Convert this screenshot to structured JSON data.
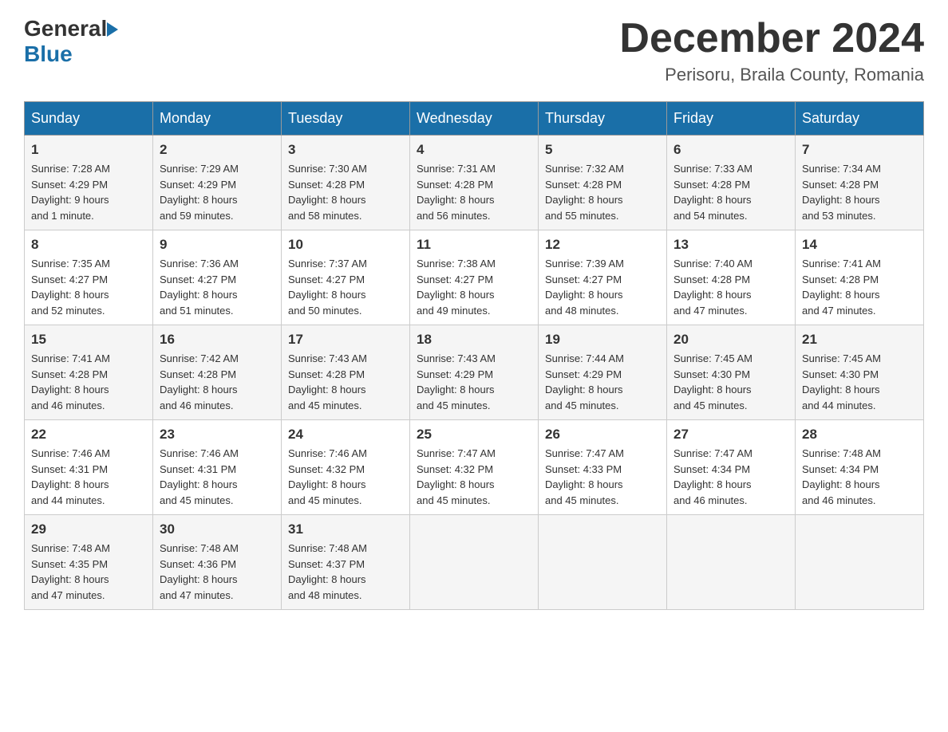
{
  "logo": {
    "general": "General",
    "blue": "Blue"
  },
  "header": {
    "month": "December 2024",
    "location": "Perisoru, Braila County, Romania"
  },
  "days_of_week": [
    "Sunday",
    "Monday",
    "Tuesday",
    "Wednesday",
    "Thursday",
    "Friday",
    "Saturday"
  ],
  "weeks": [
    [
      {
        "day": "1",
        "sunrise": "7:28 AM",
        "sunset": "4:29 PM",
        "daylight": "9 hours and 1 minute."
      },
      {
        "day": "2",
        "sunrise": "7:29 AM",
        "sunset": "4:29 PM",
        "daylight": "8 hours and 59 minutes."
      },
      {
        "day": "3",
        "sunrise": "7:30 AM",
        "sunset": "4:28 PM",
        "daylight": "8 hours and 58 minutes."
      },
      {
        "day": "4",
        "sunrise": "7:31 AM",
        "sunset": "4:28 PM",
        "daylight": "8 hours and 56 minutes."
      },
      {
        "day": "5",
        "sunrise": "7:32 AM",
        "sunset": "4:28 PM",
        "daylight": "8 hours and 55 minutes."
      },
      {
        "day": "6",
        "sunrise": "7:33 AM",
        "sunset": "4:28 PM",
        "daylight": "8 hours and 54 minutes."
      },
      {
        "day": "7",
        "sunrise": "7:34 AM",
        "sunset": "4:28 PM",
        "daylight": "8 hours and 53 minutes."
      }
    ],
    [
      {
        "day": "8",
        "sunrise": "7:35 AM",
        "sunset": "4:27 PM",
        "daylight": "8 hours and 52 minutes."
      },
      {
        "day": "9",
        "sunrise": "7:36 AM",
        "sunset": "4:27 PM",
        "daylight": "8 hours and 51 minutes."
      },
      {
        "day": "10",
        "sunrise": "7:37 AM",
        "sunset": "4:27 PM",
        "daylight": "8 hours and 50 minutes."
      },
      {
        "day": "11",
        "sunrise": "7:38 AM",
        "sunset": "4:27 PM",
        "daylight": "8 hours and 49 minutes."
      },
      {
        "day": "12",
        "sunrise": "7:39 AM",
        "sunset": "4:27 PM",
        "daylight": "8 hours and 48 minutes."
      },
      {
        "day": "13",
        "sunrise": "7:40 AM",
        "sunset": "4:28 PM",
        "daylight": "8 hours and 47 minutes."
      },
      {
        "day": "14",
        "sunrise": "7:41 AM",
        "sunset": "4:28 PM",
        "daylight": "8 hours and 47 minutes."
      }
    ],
    [
      {
        "day": "15",
        "sunrise": "7:41 AM",
        "sunset": "4:28 PM",
        "daylight": "8 hours and 46 minutes."
      },
      {
        "day": "16",
        "sunrise": "7:42 AM",
        "sunset": "4:28 PM",
        "daylight": "8 hours and 46 minutes."
      },
      {
        "day": "17",
        "sunrise": "7:43 AM",
        "sunset": "4:28 PM",
        "daylight": "8 hours and 45 minutes."
      },
      {
        "day": "18",
        "sunrise": "7:43 AM",
        "sunset": "4:29 PM",
        "daylight": "8 hours and 45 minutes."
      },
      {
        "day": "19",
        "sunrise": "7:44 AM",
        "sunset": "4:29 PM",
        "daylight": "8 hours and 45 minutes."
      },
      {
        "day": "20",
        "sunrise": "7:45 AM",
        "sunset": "4:30 PM",
        "daylight": "8 hours and 45 minutes."
      },
      {
        "day": "21",
        "sunrise": "7:45 AM",
        "sunset": "4:30 PM",
        "daylight": "8 hours and 44 minutes."
      }
    ],
    [
      {
        "day": "22",
        "sunrise": "7:46 AM",
        "sunset": "4:31 PM",
        "daylight": "8 hours and 44 minutes."
      },
      {
        "day": "23",
        "sunrise": "7:46 AM",
        "sunset": "4:31 PM",
        "daylight": "8 hours and 45 minutes."
      },
      {
        "day": "24",
        "sunrise": "7:46 AM",
        "sunset": "4:32 PM",
        "daylight": "8 hours and 45 minutes."
      },
      {
        "day": "25",
        "sunrise": "7:47 AM",
        "sunset": "4:32 PM",
        "daylight": "8 hours and 45 minutes."
      },
      {
        "day": "26",
        "sunrise": "7:47 AM",
        "sunset": "4:33 PM",
        "daylight": "8 hours and 45 minutes."
      },
      {
        "day": "27",
        "sunrise": "7:47 AM",
        "sunset": "4:34 PM",
        "daylight": "8 hours and 46 minutes."
      },
      {
        "day": "28",
        "sunrise": "7:48 AM",
        "sunset": "4:34 PM",
        "daylight": "8 hours and 46 minutes."
      }
    ],
    [
      {
        "day": "29",
        "sunrise": "7:48 AM",
        "sunset": "4:35 PM",
        "daylight": "8 hours and 47 minutes."
      },
      {
        "day": "30",
        "sunrise": "7:48 AM",
        "sunset": "4:36 PM",
        "daylight": "8 hours and 47 minutes."
      },
      {
        "day": "31",
        "sunrise": "7:48 AM",
        "sunset": "4:37 PM",
        "daylight": "8 hours and 48 minutes."
      },
      null,
      null,
      null,
      null
    ]
  ],
  "labels": {
    "sunrise": "Sunrise:",
    "sunset": "Sunset:",
    "daylight": "Daylight:"
  }
}
